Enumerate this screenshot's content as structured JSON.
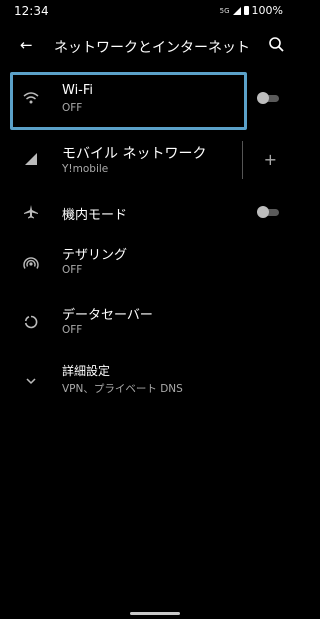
{
  "status": {
    "time": "12:34",
    "network": "5G",
    "battery": "100%"
  },
  "appbar": {
    "back_icon": "arrow-left-icon",
    "title": "ネットワークとインターネット",
    "search_icon": "search-icon"
  },
  "items": [
    {
      "title": "Wi-Fi",
      "subtitle": "OFF",
      "icon": "wifi-icon"
    },
    {
      "title": "モバイル ネットワーク",
      "subtitle": "Y!mobile",
      "icon": "cell-signal-icon",
      "action": "+"
    },
    {
      "title": "機内モード",
      "icon": "airplane-icon"
    },
    {
      "title": "テザリング",
      "subtitle": "OFF",
      "icon": "hotspot-icon"
    },
    {
      "title": "データセーバー",
      "subtitle": "OFF",
      "icon": "data-saver-icon"
    },
    {
      "title": "詳細設定",
      "subtitle": "VPN、プライベート DNS",
      "icon": "chevron-down-icon"
    }
  ],
  "colors": {
    "background": "#000000",
    "highlight": "#5ba1c9",
    "toggle_off": "#bdbdbd"
  }
}
